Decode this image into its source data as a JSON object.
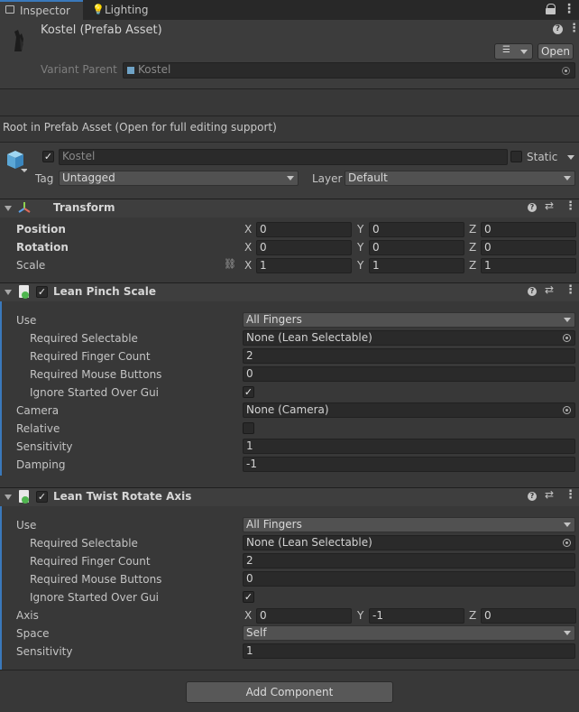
{
  "tabs": [
    {
      "label": "Inspector"
    },
    {
      "label": "Lighting"
    }
  ],
  "header": {
    "title": "Kostel (Prefab Asset)",
    "open_label": "Open",
    "variant_parent_label": "Variant Parent",
    "variant_parent_value": "Kostel"
  },
  "notice": "Root in Prefab Asset (Open for full editing support)",
  "gameobject": {
    "name": "Kostel",
    "active": true,
    "static_label": "Static",
    "tag_label": "Tag",
    "tag_value": "Untagged",
    "layer_label": "Layer",
    "layer_value": "Default"
  },
  "transform": {
    "title": "Transform",
    "position_label": "Position",
    "rotation_label": "Rotation",
    "scale_label": "Scale",
    "axis": {
      "x": "X",
      "y": "Y",
      "z": "Z"
    },
    "position": {
      "x": "0",
      "y": "0",
      "z": "0"
    },
    "rotation": {
      "x": "0",
      "y": "0",
      "z": "0"
    },
    "scale": {
      "x": "1",
      "y": "1",
      "z": "1"
    }
  },
  "pinch": {
    "title": "Lean Pinch Scale",
    "use_label": "Use",
    "use_value": "All Fingers",
    "req_sel_label": "Required Selectable",
    "req_sel_value": "None (Lean Selectable)",
    "req_finger_label": "Required Finger Count",
    "req_finger_value": "2",
    "req_mouse_label": "Required Mouse Buttons",
    "req_mouse_value": "0",
    "ignore_label": "Ignore Started Over Gui",
    "ignore_value": true,
    "camera_label": "Camera",
    "camera_value": "None (Camera)",
    "relative_label": "Relative",
    "relative_value": false,
    "sensitivity_label": "Sensitivity",
    "sensitivity_value": "1",
    "damping_label": "Damping",
    "damping_value": "-1"
  },
  "twist": {
    "title": "Lean Twist Rotate Axis",
    "use_label": "Use",
    "use_value": "All Fingers",
    "req_sel_label": "Required Selectable",
    "req_sel_value": "None (Lean Selectable)",
    "req_finger_label": "Required Finger Count",
    "req_finger_value": "2",
    "req_mouse_label": "Required Mouse Buttons",
    "req_mouse_value": "0",
    "ignore_label": "Ignore Started Over Gui",
    "ignore_value": true,
    "axis_label": "Axis",
    "axis_x": "0",
    "axis_y": "-1",
    "axis_z": "0",
    "space_label": "Space",
    "space_value": "Self",
    "sensitivity_label": "Sensitivity",
    "sensitivity_value": "1"
  },
  "add_component_label": "Add Component",
  "colors": {
    "background": "#383838",
    "accent": "#3a79bb",
    "field": "#2a2a2a"
  },
  "icons": [
    "lock-icon",
    "kebab-menu-icon",
    "help-icon",
    "presets-icon",
    "settings-icon",
    "cube-icon",
    "transform-icon",
    "script-icon",
    "link-icon",
    "object-picker-icon",
    "lighting-icon"
  ]
}
